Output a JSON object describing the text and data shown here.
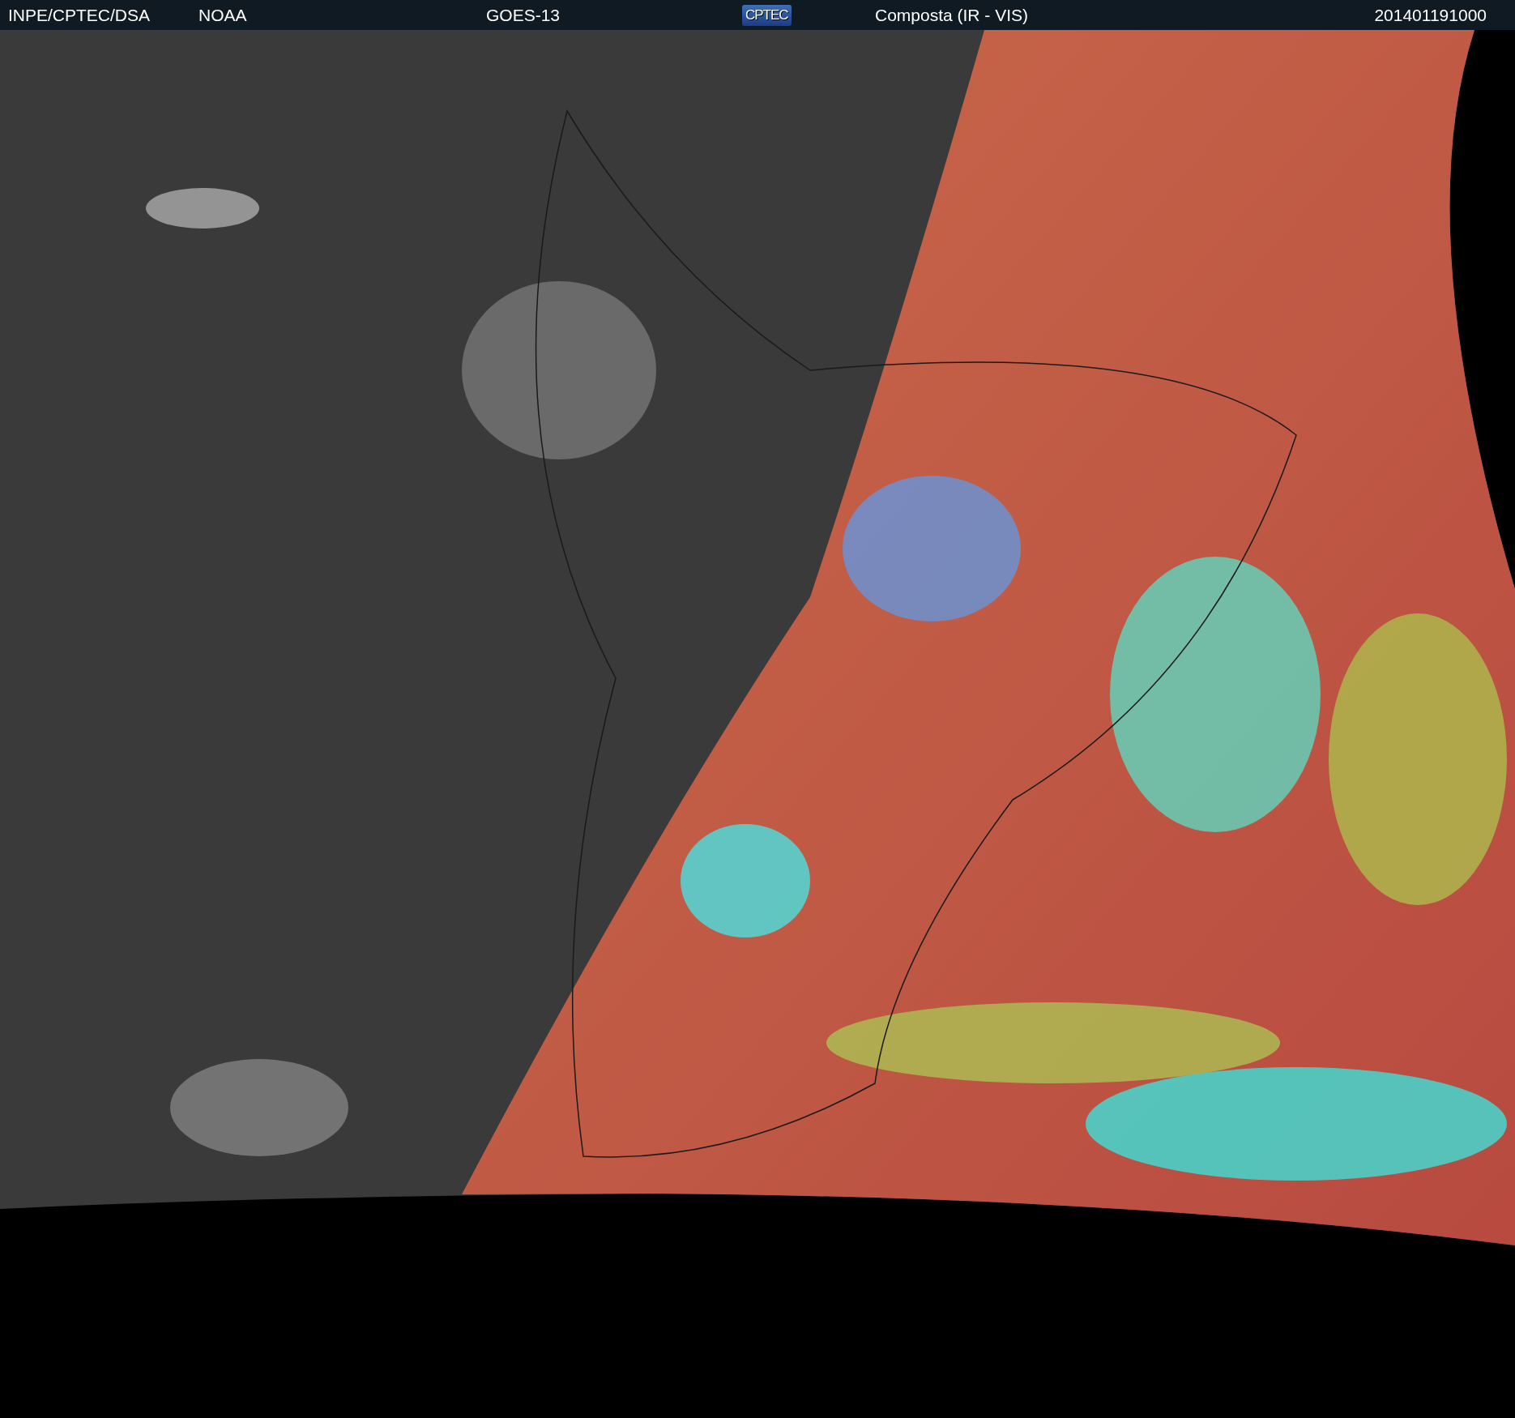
{
  "header": {
    "items": [
      {
        "kind": "text",
        "text": "INPE/CPTEC/DSA"
      },
      {
        "kind": "text",
        "text": "NOAA"
      },
      {
        "kind": "text",
        "text": "GOES-13"
      },
      {
        "kind": "logo",
        "text": "CPTEC"
      },
      {
        "kind": "text",
        "text": "Composta (IR - VIS)"
      },
      {
        "kind": "text",
        "text": "201401191000"
      }
    ]
  }
}
